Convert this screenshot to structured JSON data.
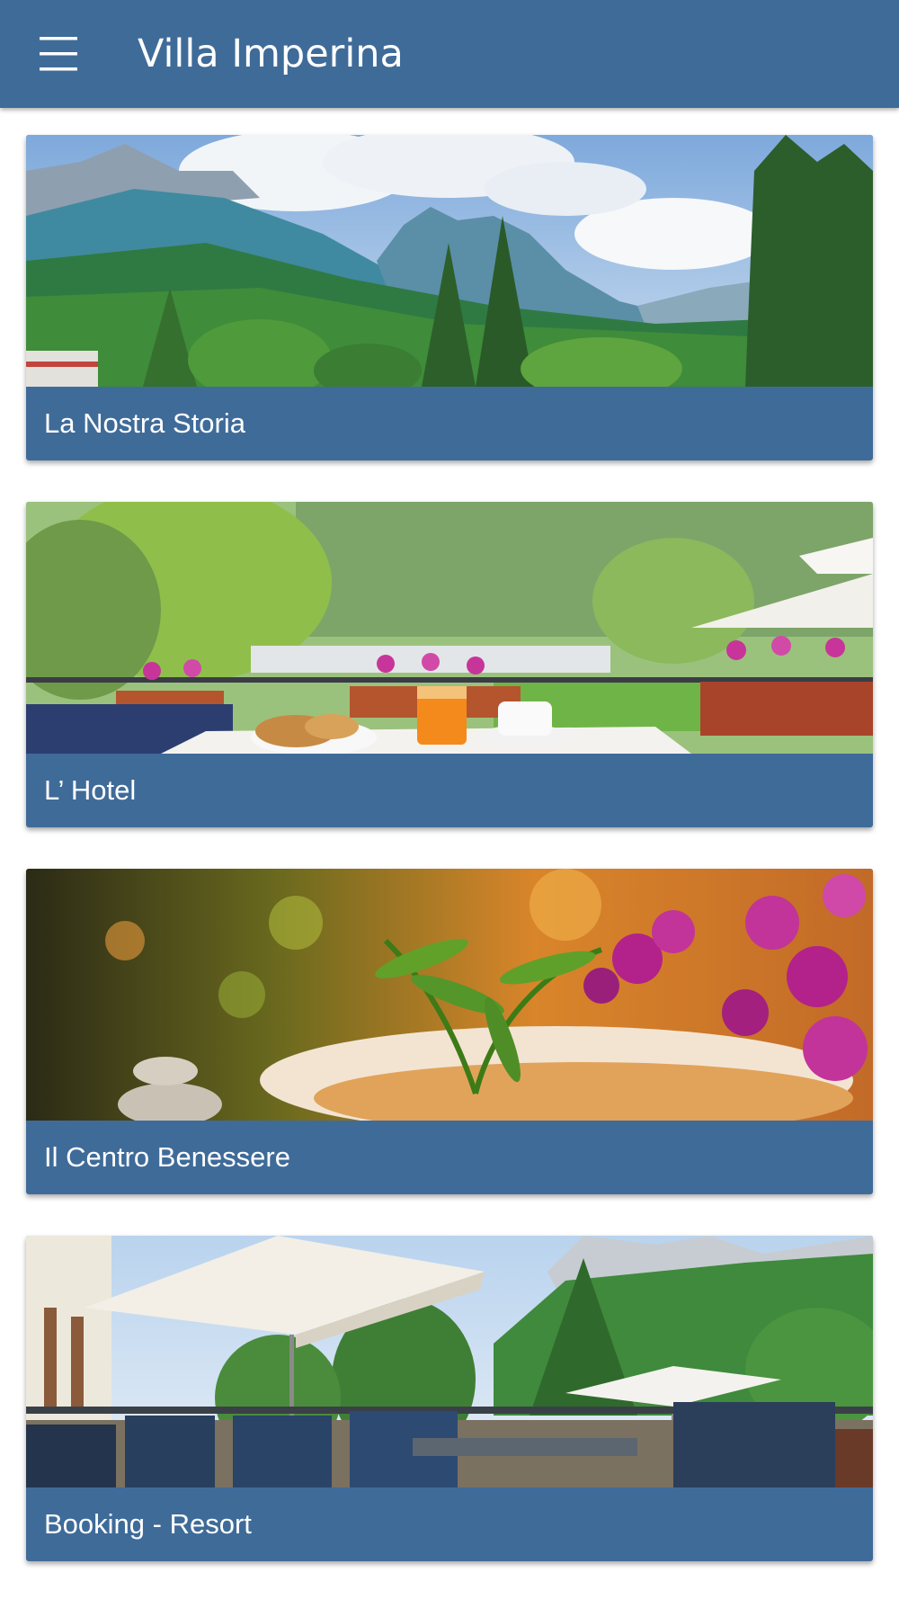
{
  "app_bar": {
    "title": "Villa Imperina",
    "menu_icon": "hamburger-menu-icon",
    "background_color": "#3f6b99"
  },
  "cards": [
    {
      "label": "La Nostra Storia",
      "image": "mountain-panorama-image"
    },
    {
      "label": "L’ Hotel",
      "image": "terrace-breakfast-image"
    },
    {
      "label": "Il Centro Benessere",
      "image": "spa-orchids-image"
    },
    {
      "label": "Booking - Resort",
      "image": "terrace-umbrellas-image"
    }
  ],
  "colors": {
    "accent": "#3f6b99",
    "text_on_accent": "#ffffff"
  }
}
